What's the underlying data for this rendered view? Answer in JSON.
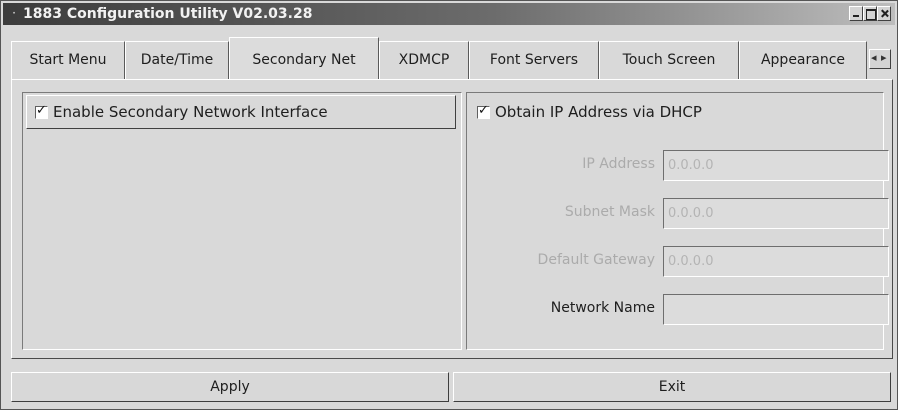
{
  "window": {
    "title": "1883 Configuration Utility V02.03.28",
    "sysmenu_icon": "dot-menu-icon"
  },
  "tabs": [
    {
      "label": "Start Menu",
      "active": false
    },
    {
      "label": "Date/Time",
      "active": false
    },
    {
      "label": "Secondary Net",
      "active": true
    },
    {
      "label": "XDMCP",
      "active": false
    },
    {
      "label": "Font Servers",
      "active": false
    },
    {
      "label": "Touch Screen",
      "active": false
    },
    {
      "label": "Appearance",
      "active": false
    }
  ],
  "secondary_net": {
    "enable_label": "Enable Secondary Network Interface",
    "enable_checked": true,
    "dhcp_label": "Obtain IP Address via DHCP",
    "dhcp_checked": true,
    "fields": {
      "ip_address": {
        "label": "IP Address",
        "value": "0.0.0.0",
        "disabled": true
      },
      "subnet_mask": {
        "label": "Subnet Mask",
        "value": "0.0.0.0",
        "disabled": true
      },
      "default_gateway": {
        "label": "Default Gateway",
        "value": "0.0.0.0",
        "disabled": true
      },
      "network_name": {
        "label": "Network Name",
        "value": "",
        "disabled": false
      }
    }
  },
  "buttons": {
    "apply_label": "Apply",
    "exit_label": "Exit"
  },
  "colors": {
    "window_bg": "#d9d9d9",
    "disabled_text": "#ababab"
  }
}
